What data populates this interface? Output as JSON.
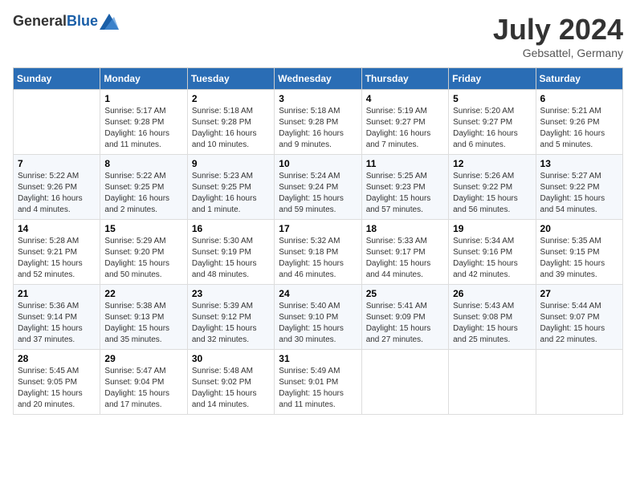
{
  "header": {
    "logo": {
      "general": "General",
      "blue": "Blue"
    },
    "title": "July 2024",
    "location": "Gebsattel, Germany"
  },
  "calendar": {
    "days_of_week": [
      "Sunday",
      "Monday",
      "Tuesday",
      "Wednesday",
      "Thursday",
      "Friday",
      "Saturday"
    ],
    "weeks": [
      [
        {
          "day": "",
          "info": ""
        },
        {
          "day": "1",
          "info": "Sunrise: 5:17 AM\nSunset: 9:28 PM\nDaylight: 16 hours\nand 11 minutes."
        },
        {
          "day": "2",
          "info": "Sunrise: 5:18 AM\nSunset: 9:28 PM\nDaylight: 16 hours\nand 10 minutes."
        },
        {
          "day": "3",
          "info": "Sunrise: 5:18 AM\nSunset: 9:28 PM\nDaylight: 16 hours\nand 9 minutes."
        },
        {
          "day": "4",
          "info": "Sunrise: 5:19 AM\nSunset: 9:27 PM\nDaylight: 16 hours\nand 7 minutes."
        },
        {
          "day": "5",
          "info": "Sunrise: 5:20 AM\nSunset: 9:27 PM\nDaylight: 16 hours\nand 6 minutes."
        },
        {
          "day": "6",
          "info": "Sunrise: 5:21 AM\nSunset: 9:26 PM\nDaylight: 16 hours\nand 5 minutes."
        }
      ],
      [
        {
          "day": "7",
          "info": "Sunrise: 5:22 AM\nSunset: 9:26 PM\nDaylight: 16 hours\nand 4 minutes."
        },
        {
          "day": "8",
          "info": "Sunrise: 5:22 AM\nSunset: 9:25 PM\nDaylight: 16 hours\nand 2 minutes."
        },
        {
          "day": "9",
          "info": "Sunrise: 5:23 AM\nSunset: 9:25 PM\nDaylight: 16 hours\nand 1 minute."
        },
        {
          "day": "10",
          "info": "Sunrise: 5:24 AM\nSunset: 9:24 PM\nDaylight: 15 hours\nand 59 minutes."
        },
        {
          "day": "11",
          "info": "Sunrise: 5:25 AM\nSunset: 9:23 PM\nDaylight: 15 hours\nand 57 minutes."
        },
        {
          "day": "12",
          "info": "Sunrise: 5:26 AM\nSunset: 9:22 PM\nDaylight: 15 hours\nand 56 minutes."
        },
        {
          "day": "13",
          "info": "Sunrise: 5:27 AM\nSunset: 9:22 PM\nDaylight: 15 hours\nand 54 minutes."
        }
      ],
      [
        {
          "day": "14",
          "info": "Sunrise: 5:28 AM\nSunset: 9:21 PM\nDaylight: 15 hours\nand 52 minutes."
        },
        {
          "day": "15",
          "info": "Sunrise: 5:29 AM\nSunset: 9:20 PM\nDaylight: 15 hours\nand 50 minutes."
        },
        {
          "day": "16",
          "info": "Sunrise: 5:30 AM\nSunset: 9:19 PM\nDaylight: 15 hours\nand 48 minutes."
        },
        {
          "day": "17",
          "info": "Sunrise: 5:32 AM\nSunset: 9:18 PM\nDaylight: 15 hours\nand 46 minutes."
        },
        {
          "day": "18",
          "info": "Sunrise: 5:33 AM\nSunset: 9:17 PM\nDaylight: 15 hours\nand 44 minutes."
        },
        {
          "day": "19",
          "info": "Sunrise: 5:34 AM\nSunset: 9:16 PM\nDaylight: 15 hours\nand 42 minutes."
        },
        {
          "day": "20",
          "info": "Sunrise: 5:35 AM\nSunset: 9:15 PM\nDaylight: 15 hours\nand 39 minutes."
        }
      ],
      [
        {
          "day": "21",
          "info": "Sunrise: 5:36 AM\nSunset: 9:14 PM\nDaylight: 15 hours\nand 37 minutes."
        },
        {
          "day": "22",
          "info": "Sunrise: 5:38 AM\nSunset: 9:13 PM\nDaylight: 15 hours\nand 35 minutes."
        },
        {
          "day": "23",
          "info": "Sunrise: 5:39 AM\nSunset: 9:12 PM\nDaylight: 15 hours\nand 32 minutes."
        },
        {
          "day": "24",
          "info": "Sunrise: 5:40 AM\nSunset: 9:10 PM\nDaylight: 15 hours\nand 30 minutes."
        },
        {
          "day": "25",
          "info": "Sunrise: 5:41 AM\nSunset: 9:09 PM\nDaylight: 15 hours\nand 27 minutes."
        },
        {
          "day": "26",
          "info": "Sunrise: 5:43 AM\nSunset: 9:08 PM\nDaylight: 15 hours\nand 25 minutes."
        },
        {
          "day": "27",
          "info": "Sunrise: 5:44 AM\nSunset: 9:07 PM\nDaylight: 15 hours\nand 22 minutes."
        }
      ],
      [
        {
          "day": "28",
          "info": "Sunrise: 5:45 AM\nSunset: 9:05 PM\nDaylight: 15 hours\nand 20 minutes."
        },
        {
          "day": "29",
          "info": "Sunrise: 5:47 AM\nSunset: 9:04 PM\nDaylight: 15 hours\nand 17 minutes."
        },
        {
          "day": "30",
          "info": "Sunrise: 5:48 AM\nSunset: 9:02 PM\nDaylight: 15 hours\nand 14 minutes."
        },
        {
          "day": "31",
          "info": "Sunrise: 5:49 AM\nSunset: 9:01 PM\nDaylight: 15 hours\nand 11 minutes."
        },
        {
          "day": "",
          "info": ""
        },
        {
          "day": "",
          "info": ""
        },
        {
          "day": "",
          "info": ""
        }
      ]
    ]
  }
}
